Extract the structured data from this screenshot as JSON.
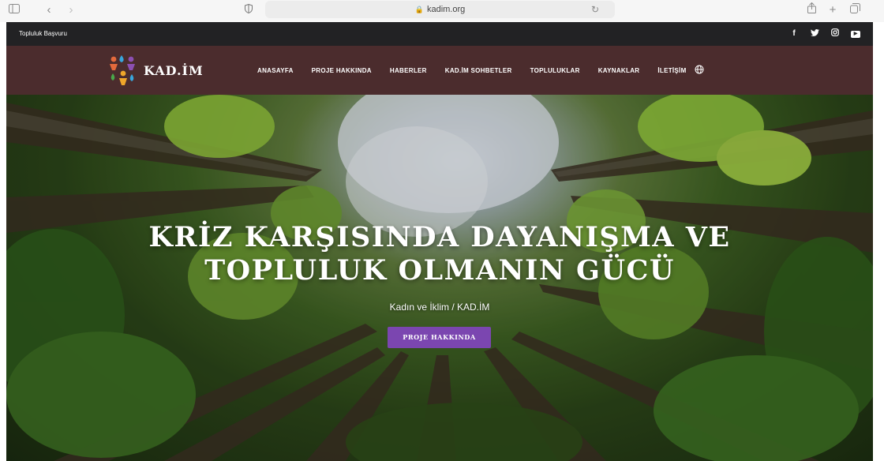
{
  "browser": {
    "url": "kadim.org",
    "icons": [
      "sidebar-icon",
      "back-icon",
      "forward-icon",
      "privacy-shield-icon",
      "lock-icon",
      "reload-icon",
      "share-icon",
      "new-tab-icon",
      "tabs-overview-icon"
    ]
  },
  "topbar": {
    "apply_link": "Topluluk Başvuru",
    "socials": [
      "facebook-icon",
      "twitter-icon",
      "instagram-icon",
      "youtube-icon"
    ]
  },
  "nav": {
    "logo_text": "KAD.İM",
    "items": [
      {
        "label": "ANASAYFA"
      },
      {
        "label": "PROJE HAKKINDA"
      },
      {
        "label": "HABERLER"
      },
      {
        "label": "KAD.İM SOHBETLER"
      },
      {
        "label": "TOPLULUKLAR"
      },
      {
        "label": "KAYNAKLAR"
      },
      {
        "label": "İLETİŞİM"
      }
    ]
  },
  "hero": {
    "title_line1": "KRİZ KARŞISINDA DAYANIŞMA VE",
    "title_line2": "TOPLULUK OLMANIN GÜCÜ",
    "subtitle": "Kadın ve İklim / KAD.İM",
    "button_label": "PROJE HAKKINDA"
  },
  "colors": {
    "topbar_bg": "#222224",
    "nav_bg": "#4b2c2d",
    "cta_bg": "#7b46b0"
  }
}
